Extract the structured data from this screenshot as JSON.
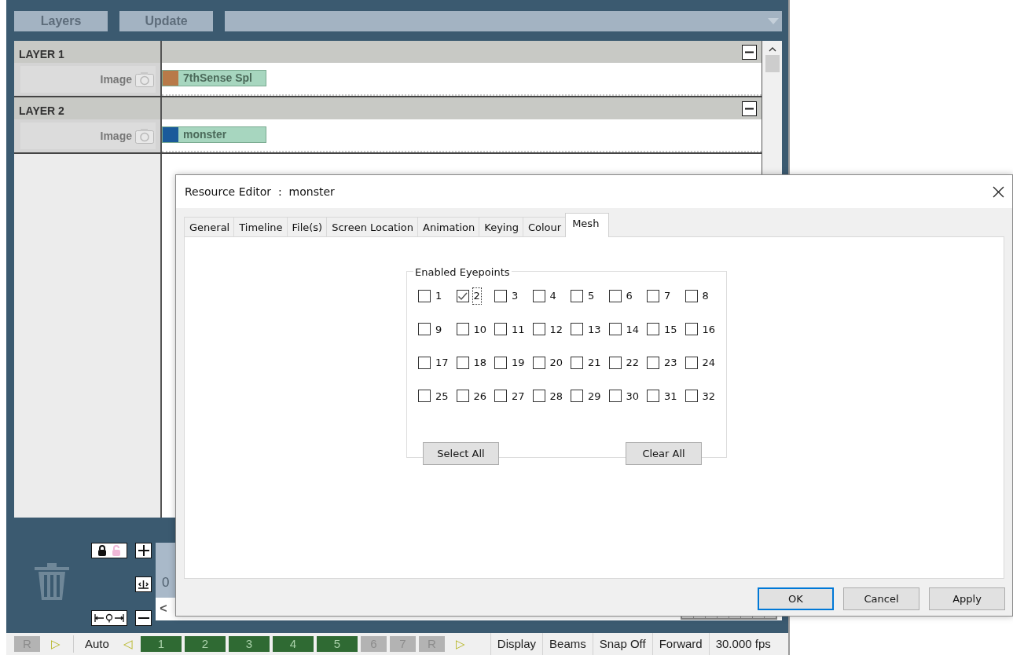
{
  "toolbar": {
    "buttons": [
      {
        "label": "Layers"
      },
      {
        "label": "Update"
      }
    ]
  },
  "layers": [
    {
      "name": "LAYER 1",
      "track_label": "Image",
      "clip": {
        "label": "7thSense Spl",
        "color": "#b87a48"
      }
    },
    {
      "name": "LAYER 2",
      "track_label": "Image",
      "clip": {
        "label": "monster",
        "color": "#1a5a9a"
      }
    }
  ],
  "lock_toggle": {
    "locked": true
  },
  "timeline": {
    "ruler_label": "0",
    "scroll_left": "<"
  },
  "status_bar": {
    "controls": [
      {
        "kind": "key",
        "label": "R",
        "on": false
      },
      {
        "kind": "arrow",
        "label": "▷"
      },
      {
        "kind": "divider"
      },
      {
        "kind": "mode",
        "label": "Auto"
      },
      {
        "kind": "arrow",
        "label": "◁"
      },
      {
        "kind": "key",
        "label": "1",
        "on": true
      },
      {
        "kind": "key",
        "label": "2",
        "on": true
      },
      {
        "kind": "key",
        "label": "3",
        "on": true
      },
      {
        "kind": "key",
        "label": "4",
        "on": true
      },
      {
        "kind": "key",
        "label": "5",
        "on": true
      },
      {
        "kind": "key",
        "label": "6",
        "on": false
      },
      {
        "kind": "key",
        "label": "7",
        "on": false
      },
      {
        "kind": "key",
        "label": "R",
        "on": false
      },
      {
        "kind": "arrow",
        "label": "▷"
      }
    ],
    "cells": [
      "Display",
      "Beams",
      "Snap Off",
      "Forward",
      "30.000 fps"
    ]
  },
  "dialog": {
    "title": "Resource Editor  :  monster",
    "tabs": [
      {
        "label": "General",
        "selected": false
      },
      {
        "label": "Timeline",
        "selected": false
      },
      {
        "label": "File(s)",
        "selected": false
      },
      {
        "label": "Screen Location",
        "selected": false
      },
      {
        "label": "Animation",
        "selected": false
      },
      {
        "label": "Keying",
        "selected": false
      },
      {
        "label": "Colour",
        "selected": false
      },
      {
        "label": "Mesh",
        "selected": true
      }
    ],
    "group": {
      "title": "Enabled Eyepoints",
      "checkboxes": [
        {
          "label": "1",
          "checked": false,
          "focused": false
        },
        {
          "label": "2",
          "checked": true,
          "focused": true
        },
        {
          "label": "3",
          "checked": false,
          "focused": false
        },
        {
          "label": "4",
          "checked": false,
          "focused": false
        },
        {
          "label": "5",
          "checked": false,
          "focused": false
        },
        {
          "label": "6",
          "checked": false,
          "focused": false
        },
        {
          "label": "7",
          "checked": false,
          "focused": false
        },
        {
          "label": "8",
          "checked": false,
          "focused": false
        },
        {
          "label": "9",
          "checked": false,
          "focused": false
        },
        {
          "label": "10",
          "checked": false,
          "focused": false
        },
        {
          "label": "11",
          "checked": false,
          "focused": false
        },
        {
          "label": "12",
          "checked": false,
          "focused": false
        },
        {
          "label": "13",
          "checked": false,
          "focused": false
        },
        {
          "label": "14",
          "checked": false,
          "focused": false
        },
        {
          "label": "15",
          "checked": false,
          "focused": false
        },
        {
          "label": "16",
          "checked": false,
          "focused": false
        },
        {
          "label": "17",
          "checked": false,
          "focused": false
        },
        {
          "label": "18",
          "checked": false,
          "focused": false
        },
        {
          "label": "19",
          "checked": false,
          "focused": false
        },
        {
          "label": "20",
          "checked": false,
          "focused": false
        },
        {
          "label": "21",
          "checked": false,
          "focused": false
        },
        {
          "label": "22",
          "checked": false,
          "focused": false
        },
        {
          "label": "23",
          "checked": false,
          "focused": false
        },
        {
          "label": "24",
          "checked": false,
          "focused": false
        },
        {
          "label": "25",
          "checked": false,
          "focused": false
        },
        {
          "label": "26",
          "checked": false,
          "focused": false
        },
        {
          "label": "27",
          "checked": false,
          "focused": false
        },
        {
          "label": "28",
          "checked": false,
          "focused": false
        },
        {
          "label": "29",
          "checked": false,
          "focused": false
        },
        {
          "label": "30",
          "checked": false,
          "focused": false
        },
        {
          "label": "31",
          "checked": false,
          "focused": false
        },
        {
          "label": "32",
          "checked": false,
          "focused": false
        }
      ],
      "buttons": [
        "Select All",
        "Clear All"
      ]
    },
    "buttons": [
      {
        "label": "OK",
        "default": true
      },
      {
        "label": "Cancel",
        "default": false
      },
      {
        "label": "Apply",
        "default": false
      }
    ]
  }
}
